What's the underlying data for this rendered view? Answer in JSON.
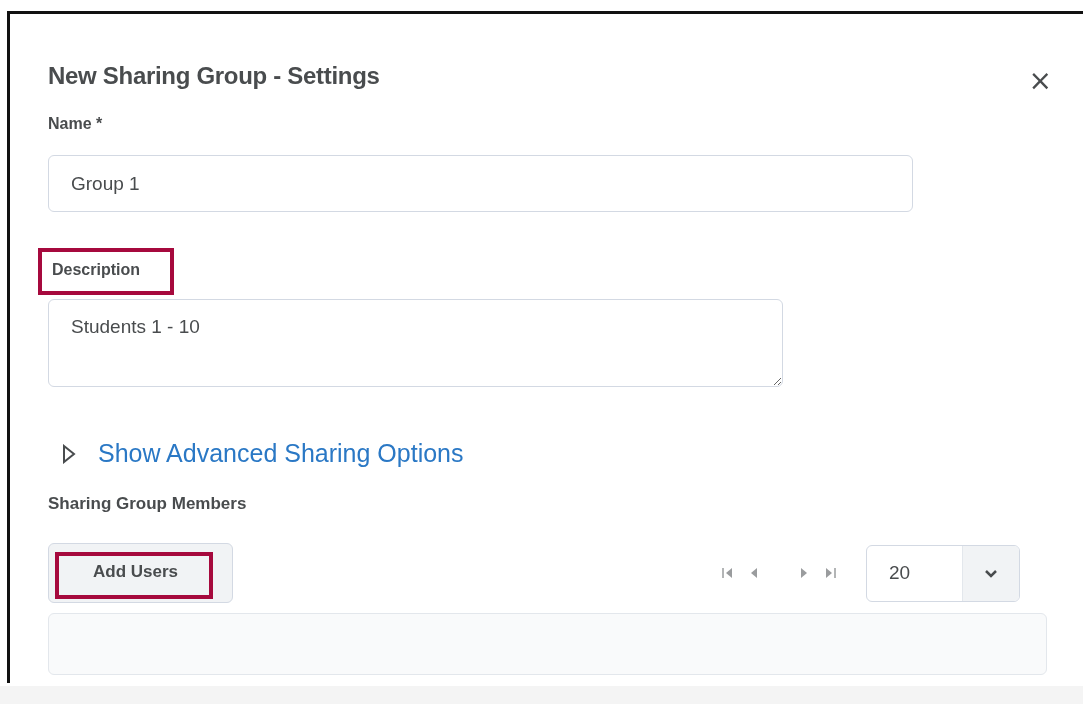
{
  "dialog": {
    "title": "New Sharing Group - Settings",
    "close": "×"
  },
  "fields": [
    {
      "kind": "input",
      "label": "Name *",
      "value": "Group 1",
      "highlighted": false
    },
    {
      "kind": "textarea",
      "label": "Description",
      "value": "Students 1 - 10",
      "highlighted": true
    }
  ],
  "advanced": {
    "label": "Show Advanced Sharing Options",
    "expanded": false
  },
  "members": {
    "label": "Sharing Group Members",
    "add_button": {
      "label": "Add Users",
      "highlighted": true
    },
    "page_size": "20"
  }
}
